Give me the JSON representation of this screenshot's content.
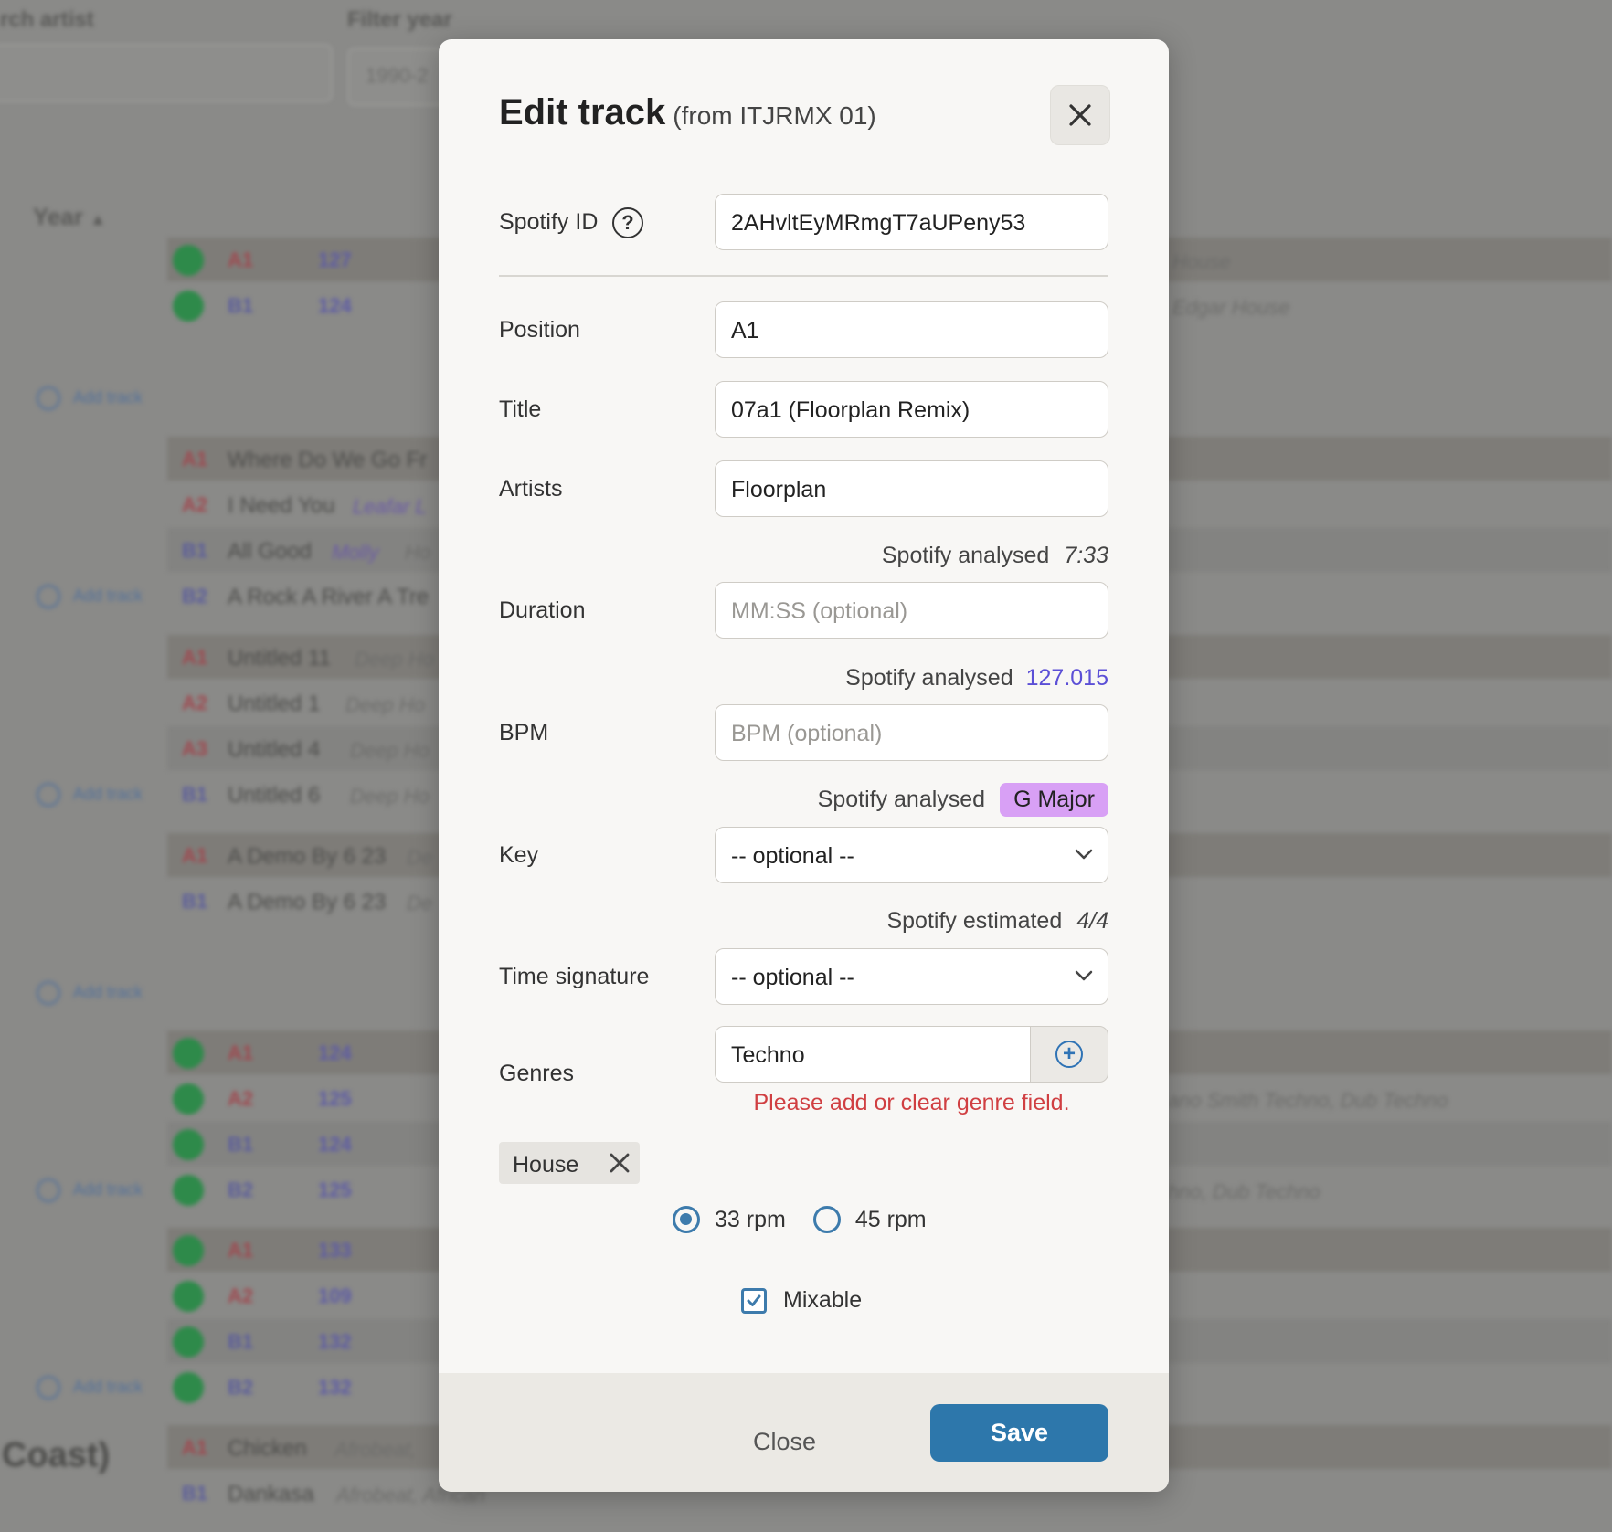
{
  "background": {
    "search_label": "rch artist",
    "filter_label": "Filter year",
    "filter_placeholder": "1990-2",
    "year_header": "Year",
    "sort_icon": "chevron-up-icon",
    "add_track_label": "Add track",
    "coast_text": "Coast)",
    "rows": [
      {
        "pos": "A1",
        "bpm": "127",
        "right": "House"
      },
      {
        "pos": "B1",
        "bpm": "124",
        "right": "Edgar  House"
      },
      {
        "pos": "A1",
        "title": "Where Do We Go Fr"
      },
      {
        "pos": "A2",
        "title": "I Need You",
        "artist": "Leafar L"
      },
      {
        "pos": "B1",
        "title": "All Good",
        "artist": "Molly",
        "genre": "Ho"
      },
      {
        "pos": "B2",
        "title": "A Rock A River A Tre"
      },
      {
        "pos": "A1",
        "title": "Untitled 11",
        "genre": "Deep Ho"
      },
      {
        "pos": "A2",
        "title": "Untitled 1",
        "genre": "Deep Ho"
      },
      {
        "pos": "A3",
        "title": "Untitled 4",
        "genre": "Deep Ho"
      },
      {
        "pos": "B1",
        "title": "Untitled 6",
        "genre": "Deep Ho"
      },
      {
        "pos": "A1",
        "title": "A Demo By 6 23",
        "genre": "De"
      },
      {
        "pos": "B1",
        "title": "A Demo By 6 23",
        "genre": "De"
      },
      {
        "pos": "A1",
        "bpm": "124"
      },
      {
        "pos": "A2",
        "bpm": "125",
        "right": "ano Smith  Techno, Dub Techno"
      },
      {
        "pos": "B1",
        "bpm": "124"
      },
      {
        "pos": "B2",
        "bpm": "125",
        "right": "hno, Dub Techno"
      },
      {
        "pos": "A1",
        "bpm": "133"
      },
      {
        "pos": "A2",
        "bpm": "109"
      },
      {
        "pos": "B1",
        "bpm": "132"
      },
      {
        "pos": "B2",
        "bpm": "132"
      },
      {
        "pos": "A1",
        "title": "Chicken",
        "genre": "Afrobeat,"
      },
      {
        "pos": "B1",
        "title": "Dankasa",
        "genre": "Afrobeat, African"
      }
    ]
  },
  "modal": {
    "title": "Edit track",
    "subtitle": "(from ITJRMX 01)",
    "close_icon": "close-icon",
    "fields": {
      "spotify_id": {
        "label": "Spotify ID",
        "value": "2AHvltEyMRmgT7aUPeny53",
        "help_icon": "question-circle-icon"
      },
      "position": {
        "label": "Position",
        "value": "A1"
      },
      "title": {
        "label": "Title",
        "value": "07a1  (Floorplan Remix)"
      },
      "artists": {
        "label": "Artists",
        "value": "Floorplan"
      },
      "duration": {
        "label": "Duration",
        "placeholder": "MM:SS (optional)",
        "hint_label": "Spotify analysed",
        "hint_value": "7:33"
      },
      "bpm": {
        "label": "BPM",
        "placeholder": "BPM (optional)",
        "hint_label": "Spotify analysed",
        "hint_value": "127.015",
        "hint_color": "#5b4fd6"
      },
      "key": {
        "label": "Key",
        "selected": "-- optional --",
        "hint_label": "Spotify analysed",
        "hint_value": "G Major",
        "badge_color": "#d8a0f5"
      },
      "time_signature": {
        "label": "Time signature",
        "selected": "-- optional --",
        "hint_label": "Spotify estimated",
        "hint_value": "4/4"
      },
      "genres": {
        "label": "Genres",
        "value": "Techno",
        "add_icon": "plus-circle-icon",
        "error": "Please add or clear genre field.",
        "error_color": "#d03f42",
        "tags": [
          "House"
        ]
      }
    },
    "rpm": {
      "options": [
        "33 rpm",
        "45 rpm"
      ],
      "selected": "33 rpm"
    },
    "mixable": {
      "label": "Mixable",
      "checked": true
    },
    "footer": {
      "close_label": "Close",
      "save_label": "Save",
      "save_color": "#2d77ab"
    }
  }
}
